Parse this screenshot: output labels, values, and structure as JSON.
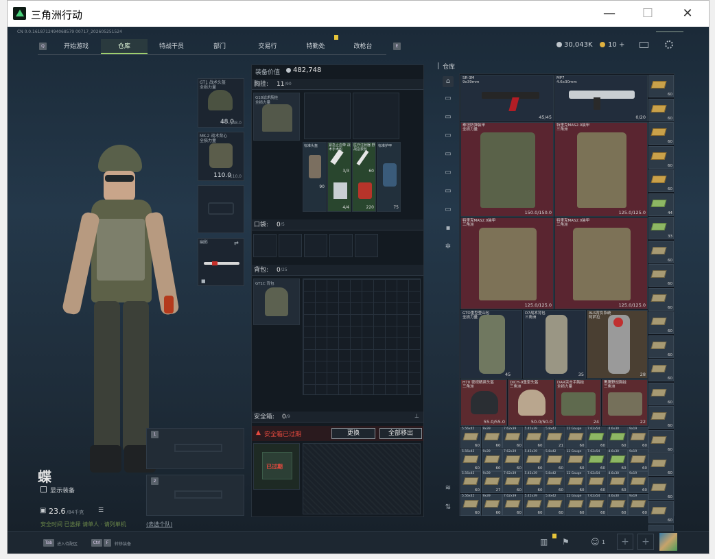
{
  "window": {
    "title": "三角洲行动",
    "minimize": "—",
    "maximize": "☐",
    "close": "✕"
  },
  "build_id": "CN 0.0.1618712494068579 00717_202605251524",
  "nav": {
    "tabs": [
      "开始游戏",
      "仓库",
      "特战干员",
      "部门",
      "交易行",
      "特勤处",
      "改枪台"
    ],
    "active": "仓库",
    "prev_key": "Q",
    "next_key": "E"
  },
  "currency": {
    "coins": "30,043K",
    "bonds": "10",
    "add": "+"
  },
  "equipment": {
    "helmet": {
      "name": "GT1 战术头盔",
      "sub": "全损力量",
      "value": "48.0",
      "max": "/48.0"
    },
    "armor": {
      "name": "MK-2 战术背心",
      "sub": "全损力量",
      "value": "110.0",
      "max": "/110.0"
    },
    "melee": {
      "name": "幽影"
    },
    "weapon_slot1": "1",
    "weapon_slot2": "2"
  },
  "operator": {
    "name": "蝶",
    "show_equipment": "显示装备",
    "weight": "23.6",
    "weight_max": "/84千克",
    "status": "安全时间 已选择 请单人 · 请列单机",
    "status_link": "(去选个队)"
  },
  "loadout": {
    "equipment_value_label": "装备价值",
    "equipment_value": "482,748",
    "chest": {
      "label": "胸挂:",
      "count": "11",
      "cap": "/90",
      "item": "G18战术胸挂",
      "item_sub": "全损力量"
    },
    "chest_items": [
      {
        "name": "标准头盔",
        "value": "90"
      },
      {
        "name": "紧急止血带 战术手术包",
        "value": "3/3",
        "value2": "4/4"
      },
      {
        "name": "医疗注射器 野战急救包",
        "value": "60",
        "value2": "220"
      },
      {
        "name": "标准护甲",
        "value": "75"
      }
    ],
    "pockets": {
      "label": "口袋:",
      "count": "0",
      "cap": "/5"
    },
    "backpack": {
      "label": "背包:",
      "count": "0",
      "cap": "/25",
      "item": "GT1C 背包"
    },
    "safebox": {
      "label": "安全箱:",
      "count": "0",
      "cap": "/9",
      "warning": "安全箱已过期",
      "renew": "更换",
      "move_all": "全部移出",
      "expired": "已过期"
    }
  },
  "warehouse": {
    "label": "仓库",
    "weapons": [
      {
        "name": "SR-3M",
        "caliber": "9x39mm",
        "value": "45/45"
      },
      {
        "name": "MP7",
        "caliber": "4.6x30mm",
        "value": "0/20"
      }
    ],
    "armors": [
      {
        "name": "泰坦防弹装甲",
        "sub": "全损力量",
        "value": "150.0/150.0"
      },
      {
        "name": "特里克MAS2.0装甲",
        "sub": "三角洲",
        "value": "125.0/125.0"
      },
      {
        "name": "特里克MAS2.0装甲",
        "sub": "三角洲",
        "value": "125.0/125.0"
      },
      {
        "name": "特里克MAS2.0装甲",
        "sub": "三角洲",
        "value": "125.0/125.0"
      }
    ],
    "packs": [
      {
        "name": "GTO重型登山包",
        "sub": "全损力量",
        "value": "45"
      },
      {
        "name": "D7战术背包",
        "sub": "三角洲",
        "value": "35"
      },
      {
        "name": "ALS背负系统",
        "sub": "阿萨拉",
        "value": "28"
      }
    ],
    "helmets": [
      {
        "name": "H70 夜视精英头盔",
        "sub": "三角洲",
        "value": "55.0/55.0"
      },
      {
        "name": "DICH-9重型头盔",
        "sub": "三角洲",
        "value": "50.0/50.0"
      },
      {
        "name": "DAR突击手胸挂",
        "sub": "全损力量",
        "value": "24"
      },
      {
        "name": "黑鹰野战胸挂",
        "sub": "三角洲",
        "value": "22"
      }
    ],
    "right_col": [
      "60",
      "60",
      "60",
      "60",
      "60",
      "44",
      "33",
      "60",
      "60",
      "60",
      "60",
      "60",
      "60",
      "60",
      "60",
      "60",
      "60",
      "60",
      "60",
      "60"
    ],
    "ammo_rows": [
      [
        "60",
        "60",
        "60",
        "60",
        "21",
        "60",
        "60",
        "60",
        "60"
      ],
      [
        "60",
        "60",
        "60",
        "60",
        "60",
        "60",
        "60",
        "60",
        "60"
      ],
      [
        "60",
        "27",
        "60",
        "60",
        "60",
        "60",
        "60",
        "60",
        "60"
      ],
      [
        "60",
        "60",
        "60",
        "60",
        "60",
        "60",
        "60",
        "60",
        "60"
      ]
    ],
    "ammo_labels": [
      "5.56x45",
      "9x39",
      "7.62x39",
      "5.45x39",
      "5.8x42",
      "12 Gauge",
      "7.62x54",
      "4.6x30",
      "9x19"
    ]
  },
  "bottom": {
    "tab_key": "Tab",
    "tab_label": "进入待配区",
    "ctrl_key": "Ctrl",
    "ctrl_label": "转移装备",
    "friends": "1"
  }
}
